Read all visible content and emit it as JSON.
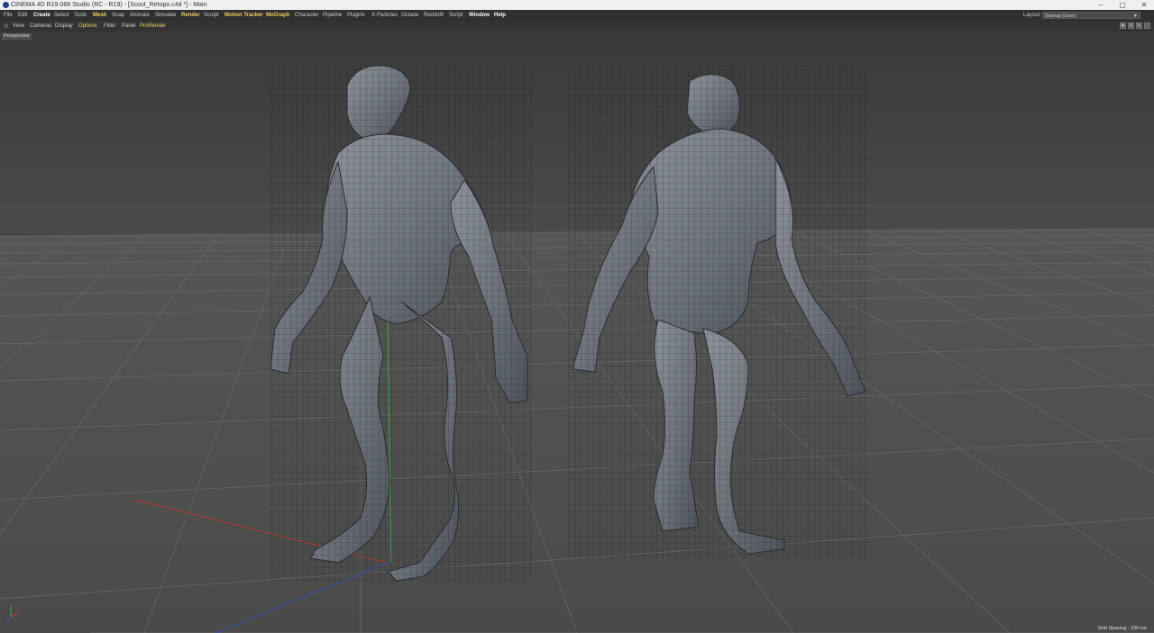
{
  "window": {
    "title": "CINEMA 4D R19.068 Studio (RC - R19) - [Scout_Retopo.c4d *] - Main",
    "minimize": "–",
    "maximize": "▢",
    "close": "✕"
  },
  "menubar": {
    "items": [
      "File",
      "Edit",
      "Create",
      "Select",
      "Tools",
      "Mesh",
      "Snap",
      "Animate",
      "Simulate",
      "Render",
      "Sculpt",
      "Motion Tracker",
      "MoGraph",
      "Character",
      "Pipeline",
      "Plugins",
      "X-Particles",
      "Octane",
      "Redshift",
      "Script",
      "Window",
      "Help"
    ],
    "layout_label": "Layout:",
    "layout_value": "Startup (User)"
  },
  "viewport_menu": {
    "items": [
      "View",
      "Cameras",
      "Display",
      "Options",
      "Filter",
      "Panel",
      "ProRender"
    ]
  },
  "viewport": {
    "camera_label": "Perspective",
    "grid_spacing": "Grid Spacing : 100 cm"
  }
}
